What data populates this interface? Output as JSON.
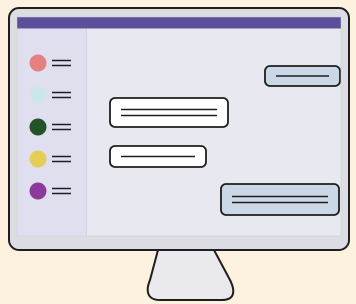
{
  "illustration": {
    "subject": "chat-app-on-monitor",
    "colors": {
      "background": "#fdf1e0",
      "monitor_frame": "#dcdde3",
      "screen": "#e8e8f0",
      "sidebar": "#dfdff0",
      "title_bar": "#5b4e9b",
      "outline": "#1e1e1e",
      "outgoing_bubble": "#c9d7e6",
      "incoming_bubble": "#ffffff",
      "stand": "#e9e9ee"
    }
  },
  "sidebar": {
    "contacts": [
      {
        "avatar_color": "#e58080"
      },
      {
        "avatar_color": "#cde6ec"
      },
      {
        "avatar_color": "#235428"
      },
      {
        "avatar_color": "#e3cf55"
      },
      {
        "avatar_color": "#8b3a9a"
      }
    ]
  },
  "chat": {
    "messages": [
      {
        "direction": "outgoing",
        "lines": 1
      },
      {
        "direction": "incoming",
        "lines": 2
      },
      {
        "direction": "incoming",
        "lines": 1
      },
      {
        "direction": "outgoing",
        "lines": 2
      }
    ]
  }
}
